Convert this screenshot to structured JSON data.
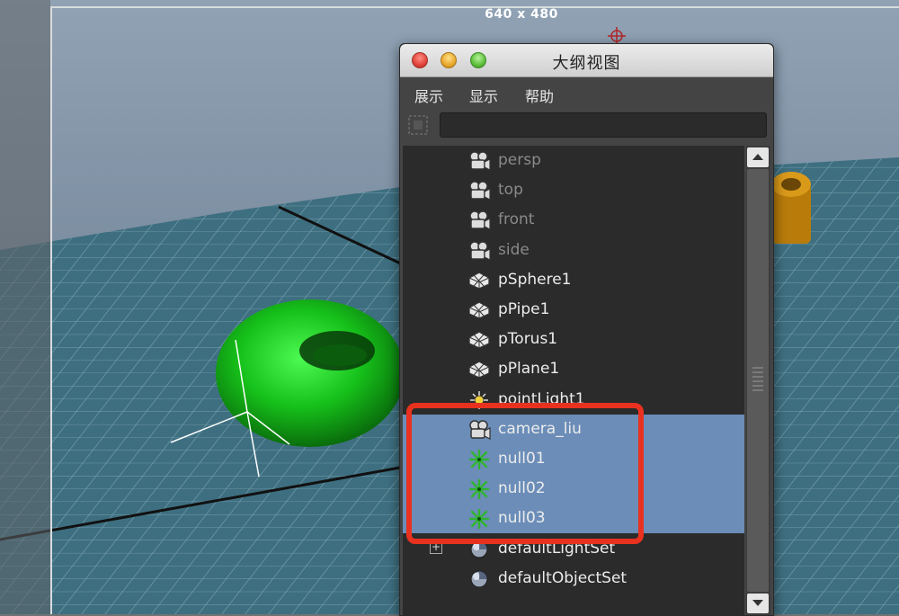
{
  "viewport": {
    "resolution_label": "640 x 480",
    "colors": {
      "floor": "#3e6f80",
      "torus_green": "#16c01a",
      "orange_object": "#b97c0a",
      "highlight": "#e8321f"
    }
  },
  "window": {
    "title": "大纲视图"
  },
  "menu": {
    "items": [
      "展示",
      "显示",
      "帮助"
    ]
  },
  "filter": {
    "value": ""
  },
  "outliner": {
    "rows": [
      {
        "label": "persp",
        "icon": "camera-icon",
        "style": "dim",
        "selected": false
      },
      {
        "label": "top",
        "icon": "camera-icon",
        "style": "dim",
        "selected": false
      },
      {
        "label": "front",
        "icon": "camera-icon",
        "style": "dim",
        "selected": false
      },
      {
        "label": "side",
        "icon": "camera-icon",
        "style": "dim",
        "selected": false
      },
      {
        "label": "pSphere1",
        "icon": "mesh-icon",
        "style": "normal",
        "selected": false
      },
      {
        "label": "pPipe1",
        "icon": "mesh-icon",
        "style": "normal",
        "selected": false
      },
      {
        "label": "pTorus1",
        "icon": "mesh-icon",
        "style": "normal",
        "selected": false
      },
      {
        "label": "pPlane1",
        "icon": "mesh-icon",
        "style": "normal",
        "selected": false
      },
      {
        "label": "pointLight1",
        "icon": "light-icon",
        "style": "normal",
        "selected": false
      },
      {
        "label": "camera_liu",
        "icon": "camera-icon",
        "style": "normal",
        "selected": true
      },
      {
        "label": "null01",
        "icon": "locator-icon",
        "style": "normal",
        "selected": true
      },
      {
        "label": "null02",
        "icon": "locator-icon",
        "style": "normal",
        "selected": true
      },
      {
        "label": "null03",
        "icon": "locator-icon",
        "style": "normal",
        "selected": true
      },
      {
        "label": "defaultLightSet",
        "icon": "set-icon",
        "style": "normal",
        "selected": false,
        "expandable": true
      },
      {
        "label": "defaultObjectSet",
        "icon": "set-icon",
        "style": "normal",
        "selected": false
      }
    ],
    "selection_color": "#6b8db8"
  }
}
